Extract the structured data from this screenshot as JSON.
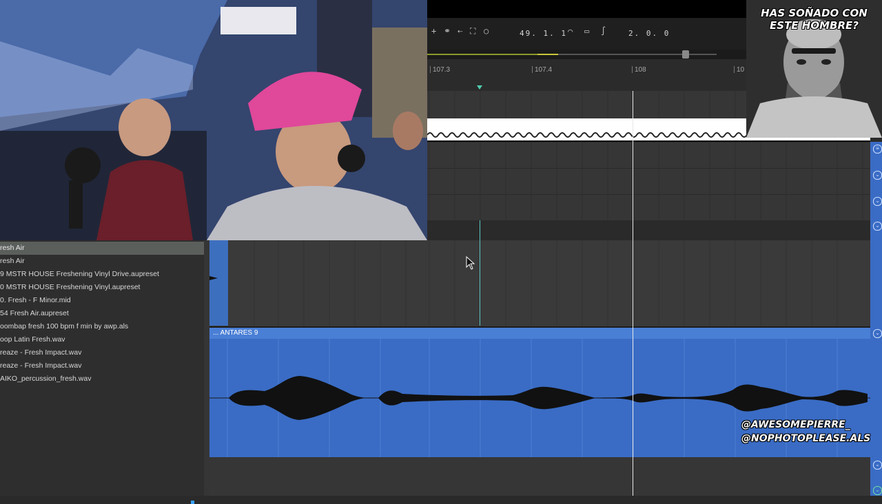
{
  "meme": {
    "caption": "HAS SOÑADO CON ESTE HOMBRE?"
  },
  "overlay": {
    "handle_1": "@AWESOMEPIERRE_",
    "handle_2": "@NOPHOTOPLEASE.ALS"
  },
  "transport": {
    "position": "49. 1. 1",
    "loop_length": "2. 0. 0"
  },
  "ruler": {
    "marks": [
      "107.3",
      "107.4",
      "108",
      "10"
    ]
  },
  "browser": {
    "items": [
      {
        "label": "resh Air",
        "selected": true
      },
      {
        "label": "resh Air",
        "selected": false
      },
      {
        "label": "9 MSTR HOUSE Freshening Vinyl Drive.aupreset",
        "selected": false
      },
      {
        "label": "0 MSTR HOUSE Freshening Vinyl.aupreset",
        "selected": false
      },
      {
        "label": "0. Fresh - F Minor.mid",
        "selected": false
      },
      {
        "label": "54 Fresh Air.aupreset",
        "selected": false
      },
      {
        "label": "oombap fresh 100 bpm f min by awp.als",
        "selected": false
      },
      {
        "label": "oop Latin Fresh.wav",
        "selected": false
      },
      {
        "label": "reaze - Fresh Impact.wav",
        "selected": false
      },
      {
        "label": "reaze - Fresh Impact.wav",
        "selected": false
      },
      {
        "label": "AIKO_percussion_fresh.wav",
        "selected": false
      }
    ]
  },
  "clip": {
    "name": "... ANTARES 9",
    "color": "#3a6cc5"
  }
}
